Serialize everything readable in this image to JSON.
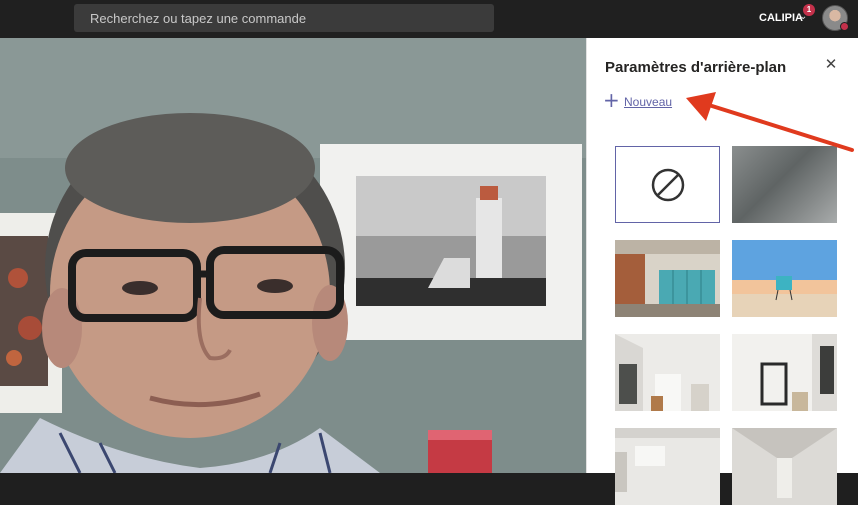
{
  "topbar": {
    "search_placeholder": "Recherchez ou tapez une commande",
    "org_name": "CALIPIA",
    "notification_count": "1"
  },
  "panel": {
    "title": "Paramètres d'arrière-plan",
    "new_label": "Nouveau",
    "backgrounds": [
      {
        "name": "none",
        "selected": true
      },
      {
        "name": "blur"
      },
      {
        "name": "office-lockers"
      },
      {
        "name": "beach-lifeguard"
      },
      {
        "name": "white-room-1"
      },
      {
        "name": "white-room-2"
      },
      {
        "name": "white-room-3"
      },
      {
        "name": "white-room-4"
      }
    ]
  },
  "colors": {
    "accent": "#6264a7",
    "annotation_arrow": "#e03a1e",
    "topbar_bg": "#202020",
    "badge": "#c4314b"
  }
}
